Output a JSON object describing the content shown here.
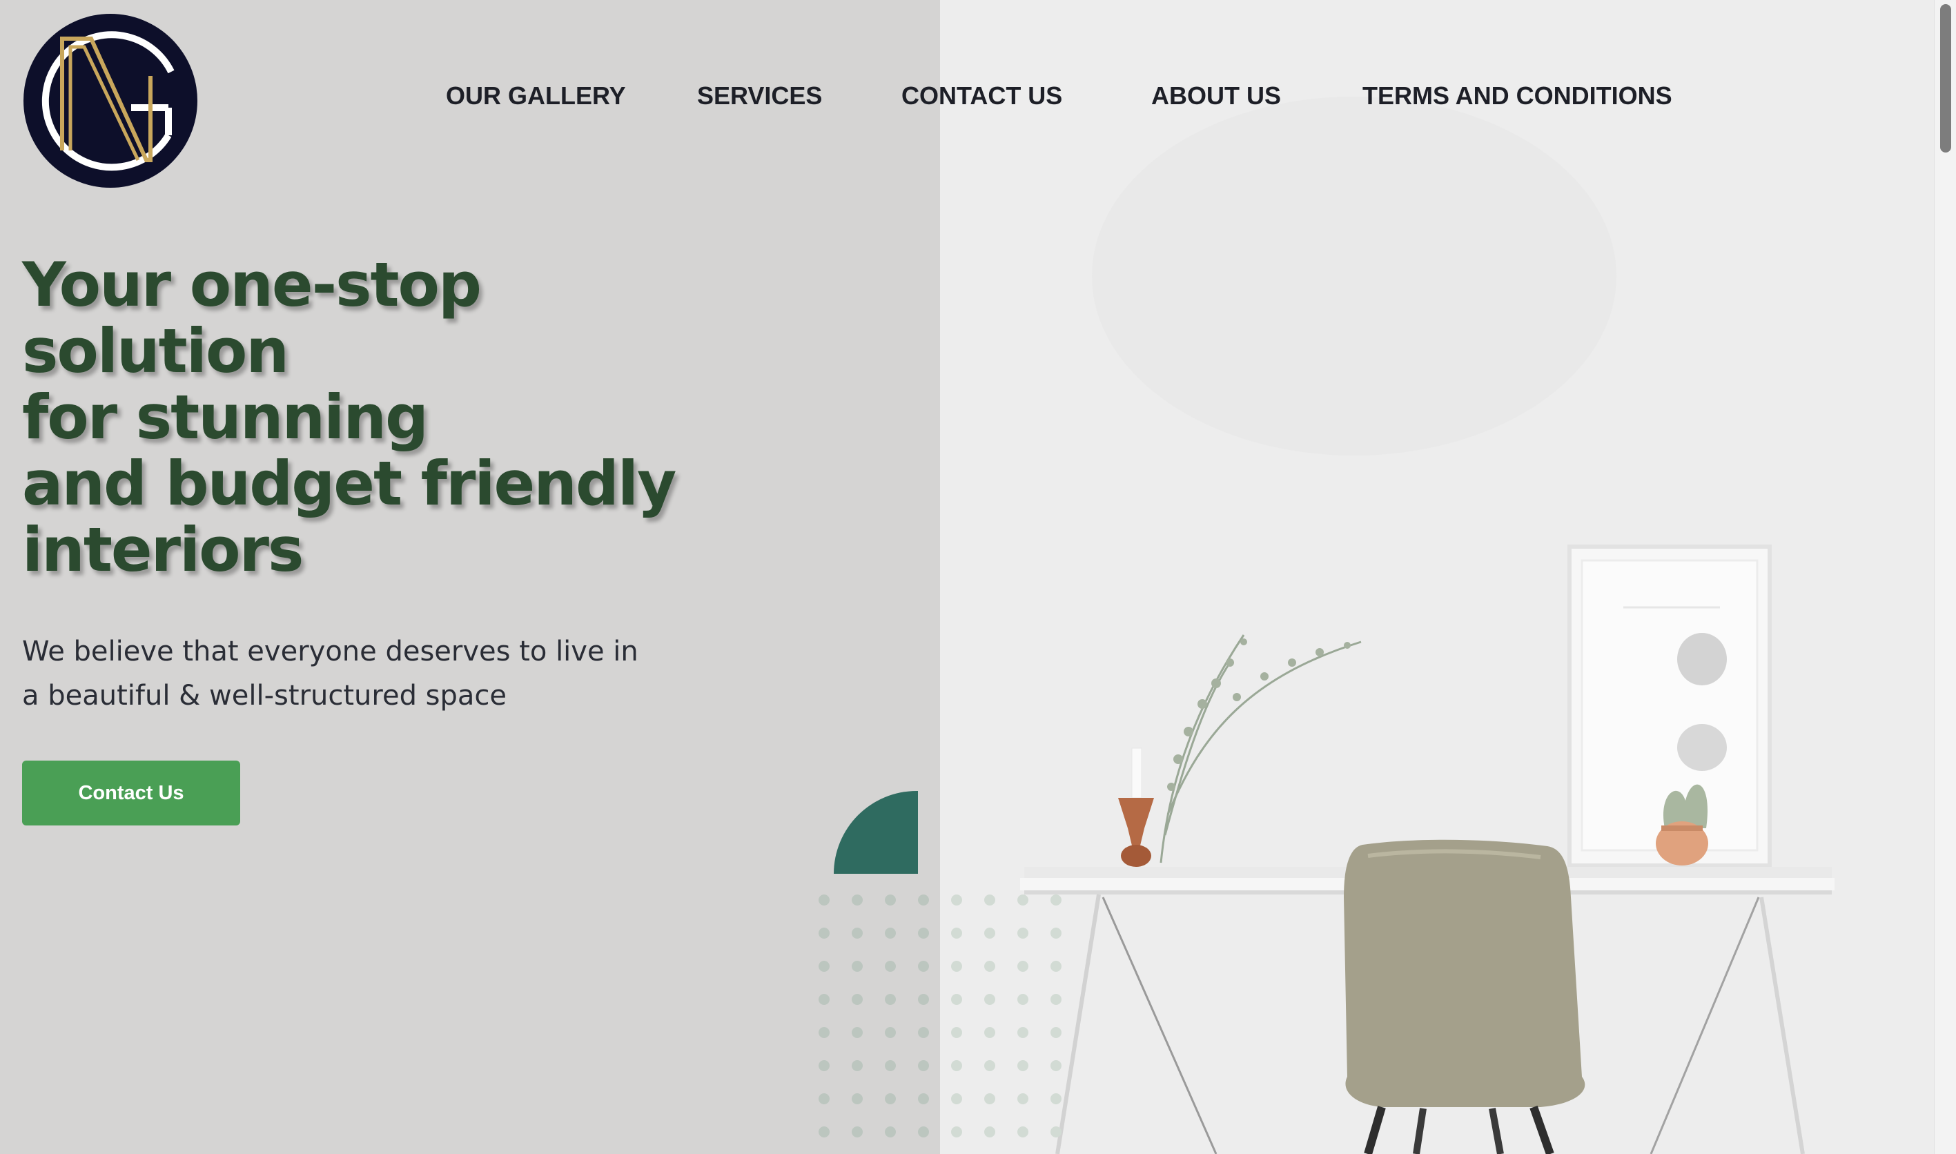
{
  "brand": {
    "logo_monogram": "NG",
    "logo_colors": {
      "background": "#0d0f2a",
      "ring": "#ffffff",
      "letters": "#c9a75c"
    }
  },
  "nav": {
    "items": [
      {
        "label": "OUR GALLERY"
      },
      {
        "label": "SERVICES"
      },
      {
        "label": "CONTACT US"
      },
      {
        "label": "ABOUT US"
      },
      {
        "label": "TERMS AND CONDITIONS"
      }
    ]
  },
  "hero": {
    "title_lines": [
      "Your one-stop",
      "solution",
      "for stunning",
      "and budget friendly",
      "interiors"
    ],
    "subtitle_lines": [
      "We believe that everyone deserves to live in",
      "a beautiful & well-structured space"
    ],
    "cta_label": "Contact Us"
  },
  "colors": {
    "accent_green": "#4a9f55",
    "title_green": "#2b4a2f",
    "decor_teal": "#2f6b60",
    "left_panel": "#d5d4d3"
  }
}
